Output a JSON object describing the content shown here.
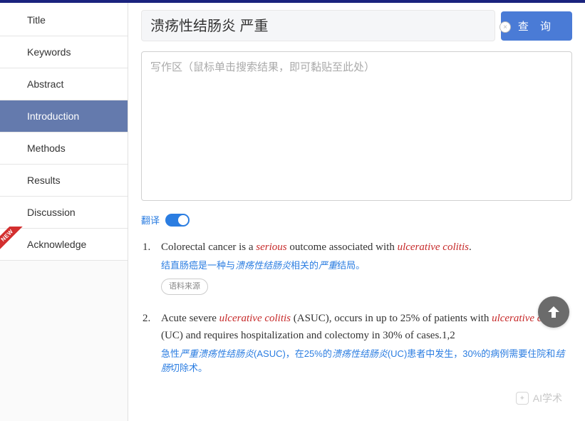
{
  "sidebar": {
    "items": [
      {
        "label": "Title"
      },
      {
        "label": "Keywords"
      },
      {
        "label": "Abstract"
      },
      {
        "label": "Introduction"
      },
      {
        "label": "Methods"
      },
      {
        "label": "Results"
      },
      {
        "label": "Discussion"
      },
      {
        "label": "Acknowledge"
      }
    ]
  },
  "search": {
    "value": "溃疡性结肠炎 严重",
    "clear": "×",
    "button": "查 询"
  },
  "writeArea": {
    "placeholder": "写作区（鼠标单击搜索结果，即可黏贴至此处）"
  },
  "translate": {
    "label": "翻译"
  },
  "results": [
    {
      "en_pre": "Colorectal cancer is a ",
      "en_hl1": "serious",
      "en_mid": " outcome associated with ",
      "en_hl2": "ulcerative colitis",
      "en_post": ".",
      "zh_pre": "结直肠癌是一种与",
      "zh_kw1": "溃疡性结肠炎",
      "zh_mid": "相关的",
      "zh_kw2": "严重",
      "zh_post": "结局。",
      "source": "语料来源"
    },
    {
      "en_pre": "Acute severe ",
      "en_hl1": "ulcerative colitis",
      "en_mid": " (ASUC), occurs in up to 25% of patients with ",
      "en_hl2": "ulcerative colitis",
      "en_post": " (UC) and requires hospitalization and colectomy in 30% of cases.1,2",
      "zh_pre": "急性",
      "zh_kw1": "严重溃疡性结肠炎",
      "zh_mid": "(ASUC)，在25%的",
      "zh_kw2": "溃疡性结肠炎",
      "zh_mid2": "(UC)患者中发生，30%的病例需要住院和",
      "zh_kw3": "结肠",
      "zh_post": "切除术。"
    }
  ],
  "watermark": "AI学术"
}
